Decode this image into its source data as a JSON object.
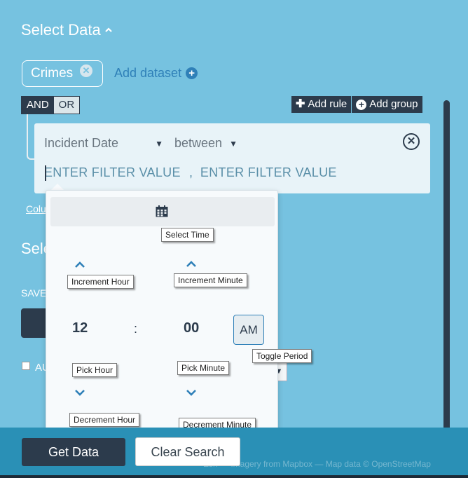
{
  "data_section": {
    "title": "Select Data",
    "chip_label": "Crimes",
    "add_dataset_label": "Add dataset"
  },
  "query_builder": {
    "and_label": "AND",
    "or_label": "OR",
    "add_rule_label": "Add rule",
    "add_group_label": "Add group",
    "rule": {
      "field": "Incident Date",
      "operator": "between",
      "value1_placeholder": "ENTER FILTER VALUE",
      "separator": ",",
      "value2_placeholder": "ENTER FILTER VALUE"
    }
  },
  "background": {
    "link_partial": "Colu",
    "heading_partial": "Sele",
    "save_partial": "SAVE",
    "auto_partial": "AU"
  },
  "time_picker": {
    "select_time_tip": "Select Time",
    "increment_hour_tip": "Increment Hour",
    "increment_minute_tip": "Increment Minute",
    "hour": "12",
    "colon": ":",
    "minute": "00",
    "period": "AM",
    "toggle_period_tip": "Toggle Period",
    "pick_hour_tip": "Pick Hour",
    "pick_minute_tip": "Pick Minute",
    "decrement_hour_tip": "Decrement Hour",
    "decrement_minute_tip": "Decrement Minute"
  },
  "footer": {
    "get_data_label": "Get Data",
    "clear_search_label": "Clear Search",
    "attribution": "Esri — Imagery from Mapbox — Map data © OpenStreetMap"
  },
  "colors": {
    "page_bg": "#76c2e0",
    "dark": "#2c3b4c",
    "accent": "#2f80b8",
    "footer_bg": "#2a90b6"
  }
}
